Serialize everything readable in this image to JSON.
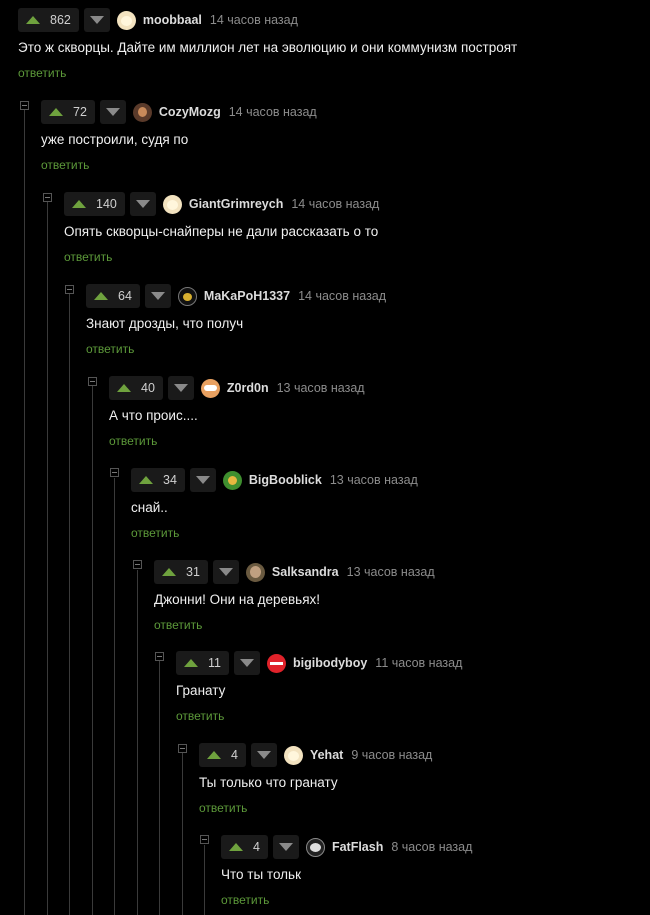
{
  "comments": [
    {
      "rating": "862",
      "author": "moobbaal",
      "time": "14 часов назад",
      "text": "Это ж скворцы. Дайте им миллион лет на эволюцию и они коммунизм построят",
      "reply": "ответить",
      "avatar": "egg-avatar"
    },
    {
      "rating": "72",
      "author": "CozyMozg",
      "time": "14 часов назад",
      "text": "уже построили, судя по",
      "reply": "ответить",
      "avatar": "portrait-avatar"
    },
    {
      "rating": "140",
      "author": "GiantGrimreych",
      "time": "14 часов назад",
      "text": "Опять скворцы-снайперы не дали рассказать о то",
      "reply": "ответить",
      "avatar": "egg-avatar"
    },
    {
      "rating": "64",
      "author": "MaKaPoH1337",
      "time": "14 часов назад",
      "text": "Знают дрозды, что получ",
      "reply": "ответить",
      "avatar": "dark-avatar"
    },
    {
      "rating": "40",
      "author": "Z0rd0n",
      "time": "13 часов назад",
      "text": "А что проис....",
      "reply": "ответить",
      "avatar": "face-avatar"
    },
    {
      "rating": "34",
      "author": "BigBooblick",
      "time": "13 часов назад",
      "text": "снай..",
      "reply": "ответить",
      "avatar": "green-avatar"
    },
    {
      "rating": "31",
      "author": "Salksandra",
      "time": "13 часов назад",
      "text": "Джонни! Они на деревьях!",
      "reply": "ответить",
      "avatar": "photo-avatar"
    },
    {
      "rating": "11",
      "author": "bigibodyboy",
      "time": "11 часов назад",
      "text": "Гранату",
      "reply": "ответить",
      "avatar": "stop-sign-avatar"
    },
    {
      "rating": "4",
      "author": "Yehat",
      "time": "9 часов назад",
      "text": "Ты только что гранату",
      "reply": "ответить",
      "avatar": "egg-avatar"
    },
    {
      "rating": "4",
      "author": "FatFlash",
      "time": "8 часов назад",
      "text": "Что ты тольк",
      "reply": "ответить",
      "avatar": "bw-avatar"
    }
  ],
  "colors": {
    "background": "#000000",
    "upvote": "#6fa23e",
    "downvote": "#8a8a8a",
    "reply_link": "#5d9a3a",
    "author": "#dcdcdc",
    "timestamp": "#8c8c8c",
    "thread_line": "#3a3a3a"
  }
}
